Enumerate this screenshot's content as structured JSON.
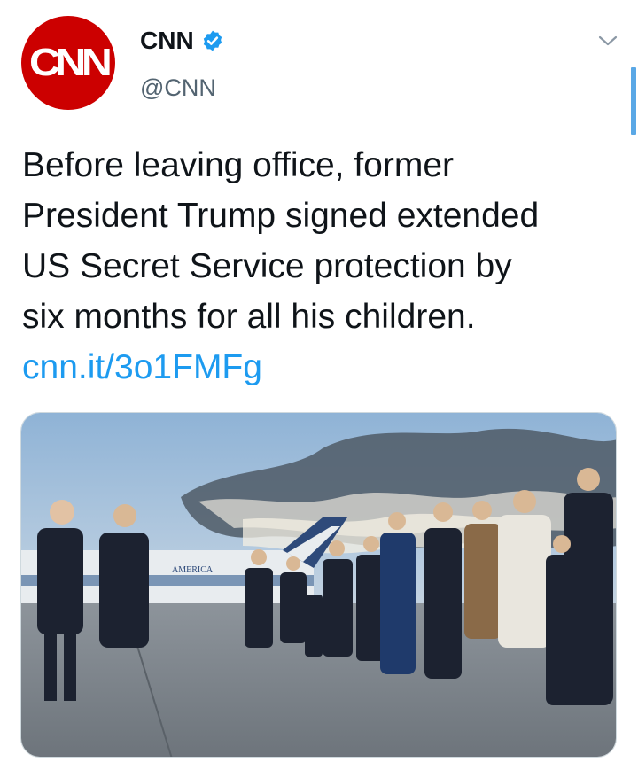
{
  "tweet": {
    "avatar_text": "CNN",
    "avatar_color": "#cc0000",
    "display_name": "CNN",
    "verified": true,
    "verified_icon": "verified-badge-icon",
    "handle": "@CNN",
    "more_icon": "chevron-down-icon",
    "text": "Before leaving office, former\nPresident Trump signed extended\nUS Secret Service protection by\nsix months for all his children.",
    "link": "cnn.it/3o1FMFg",
    "link_color": "#1d9bf0",
    "media": {
      "plane_label": "AMERICA"
    }
  }
}
